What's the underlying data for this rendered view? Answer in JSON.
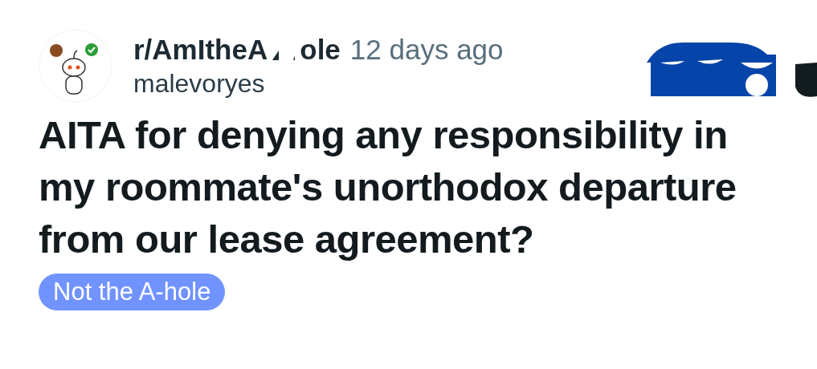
{
  "post": {
    "subreddit_parts": [
      "r/AmItheA",
      "ole"
    ],
    "time": "12 days ago",
    "author": "malevoryes",
    "title": "AITA for denying any responsibility in my roommate's unorthodox departure from our lease agreement?",
    "flair": {
      "label": "Not the A-hole",
      "color": "#7193ff"
    }
  }
}
